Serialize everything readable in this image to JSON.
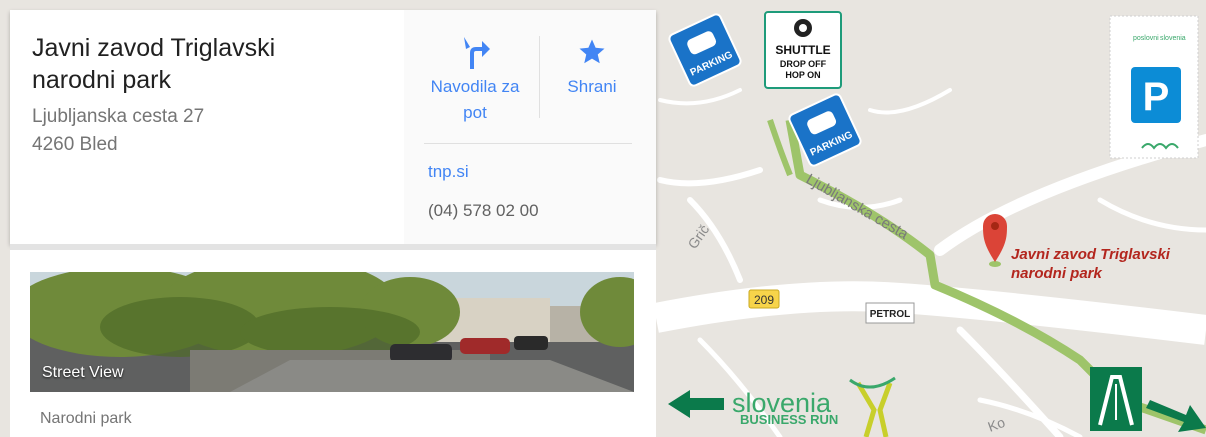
{
  "place": {
    "title": "Javni zavod Triglavski narodni park",
    "address_line1": "Ljubljanska cesta 27",
    "address_line2": "4260 Bled",
    "category": "Narodni park"
  },
  "actions": {
    "directions_label": "Navodila za pot",
    "directions_icon": "directions-icon",
    "save_label": "Shrani",
    "save_icon": "star-icon"
  },
  "contact": {
    "website": "tnp.si",
    "phone": "(04) 578 02 00"
  },
  "street_view": {
    "label": "Street View"
  },
  "map": {
    "parking_label": "PARKING",
    "shuttle_line1": "SHUTTLE",
    "shuttle_line2": "DROP OFF",
    "shuttle_line3": "HOP ON",
    "road_ljubljanska": "Ljubljanska cesta",
    "road_gric": "Grič",
    "road_number": "209",
    "petrol_label": "PETROL",
    "marker_line1": "Javni zavod Triglavski",
    "marker_line2": "narodni park",
    "parking_sign_letter": "P",
    "sponsor_left": "poslovni",
    "sponsor_right": "slovenia",
    "slovenia_word": "slovenia",
    "business_run": "BUSINESS RUN",
    "partial_road": "Ko",
    "colors": {
      "accent_blue": "#4285f4",
      "parking_blue": "#1a73c8",
      "route_green": "#9ec46a",
      "marker_red": "#db4437",
      "motorway_green": "#0b7a4b",
      "slovenia_green": "#3aa86b"
    }
  }
}
